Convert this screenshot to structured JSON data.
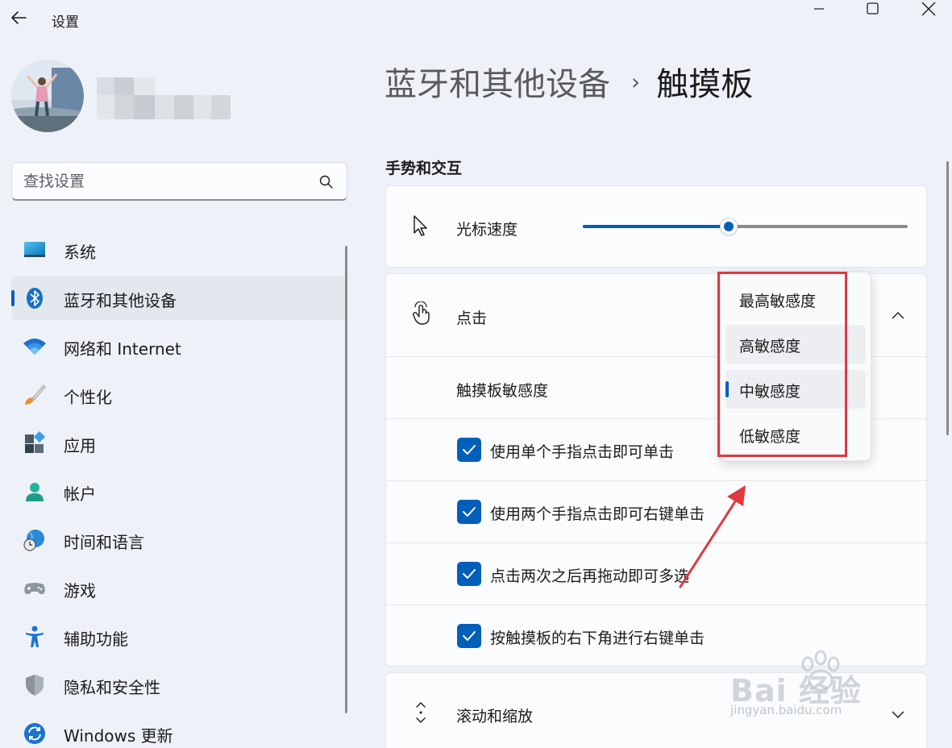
{
  "window": {
    "title": "设置",
    "controls": [
      "minimize",
      "maximize",
      "close"
    ]
  },
  "search": {
    "placeholder": "查找设置"
  },
  "nav": {
    "items": [
      {
        "label": "系统",
        "icon": "system-display-icon",
        "selected": false
      },
      {
        "label": "蓝牙和其他设备",
        "icon": "bluetooth-icon",
        "selected": true
      },
      {
        "label": "网络和 Internet",
        "icon": "wifi-icon",
        "selected": false
      },
      {
        "label": "个性化",
        "icon": "paint-brush-icon",
        "selected": false
      },
      {
        "label": "应用",
        "icon": "apps-icon",
        "selected": false
      },
      {
        "label": "帐户",
        "icon": "person-icon",
        "selected": false
      },
      {
        "label": "时间和语言",
        "icon": "globe-clock-icon",
        "selected": false
      },
      {
        "label": "游戏",
        "icon": "gamepad-icon",
        "selected": false
      },
      {
        "label": "辅助功能",
        "icon": "accessibility-icon",
        "selected": false
      },
      {
        "label": "隐私和安全性",
        "icon": "shield-icon",
        "selected": false
      },
      {
        "label": "Windows 更新",
        "icon": "update-icon",
        "selected": false
      }
    ]
  },
  "breadcrumb": {
    "parent": "蓝牙和其他设备",
    "separator": "›",
    "current": "触摸板"
  },
  "section": {
    "title": "手势和交互"
  },
  "cursor_speed": {
    "label": "光标速度",
    "value_fraction": 0.45
  },
  "tap": {
    "label": "点击",
    "expanded": true,
    "sensitivity_label": "触摸板敏感度",
    "options": [
      {
        "label": "使用单个手指点击即可单击",
        "checked": true
      },
      {
        "label": "使用两个手指点击即可右键单击",
        "checked": true
      },
      {
        "label": "点击两次之后再拖动即可多选",
        "checked": true
      },
      {
        "label": "按触摸板的右下角进行右键单击",
        "checked": true
      }
    ]
  },
  "sensitivity_dropdown": {
    "items": [
      "最高敏感度",
      "高敏感度",
      "中敏感度",
      "低敏感度"
    ],
    "selected": "中敏感度"
  },
  "scroll_zoom": {
    "label": "滚动和缩放"
  },
  "watermark": {
    "text": "Bai 经验",
    "sub": "jingyan.baidu.com"
  },
  "colors": {
    "accent": "#005fb8",
    "annotation": "#e0393e"
  }
}
